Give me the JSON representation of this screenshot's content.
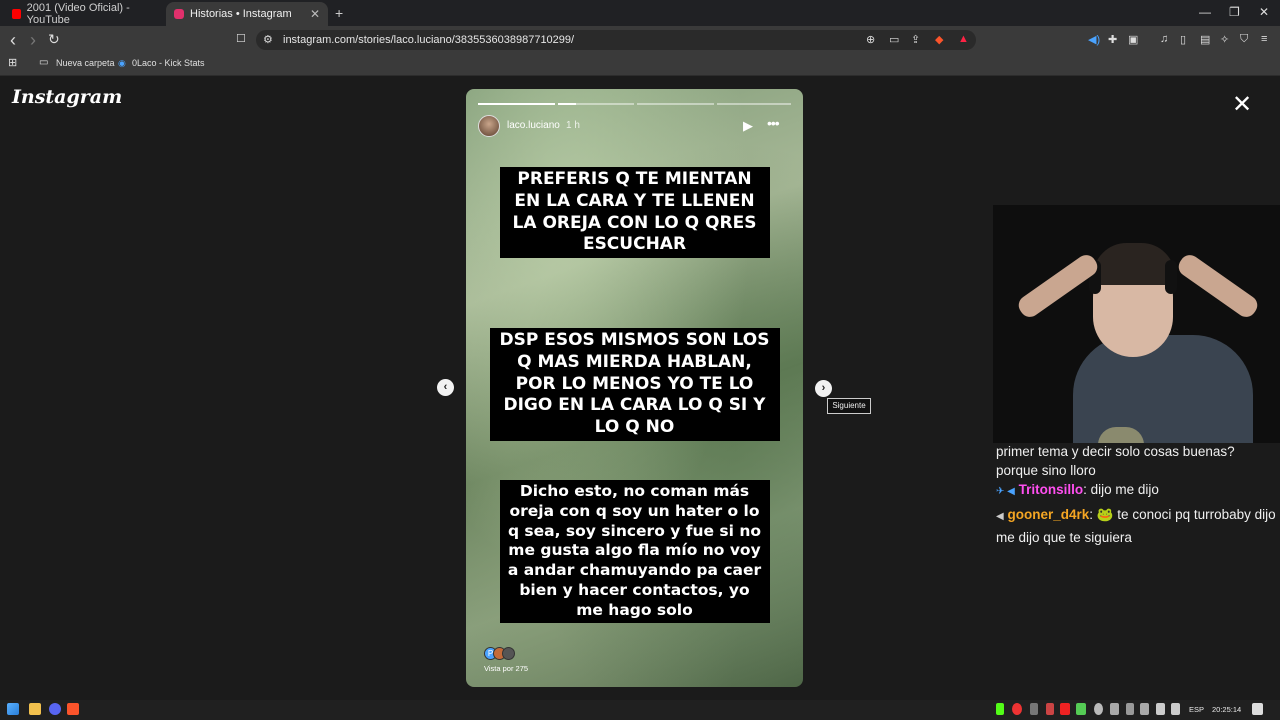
{
  "browser": {
    "tabs": [
      {
        "title": "2001 (Video Oficial) - YouTube",
        "active": false,
        "favicon_color": "#ff0000"
      },
      {
        "title": "Historias • Instagram",
        "active": true,
        "favicon_color": "#e1306c"
      }
    ],
    "new_tab_label": "+",
    "window_controls": {
      "minimize": "—",
      "restore": "❐",
      "close": "✕"
    },
    "nav": {
      "back": "‹",
      "forward": "›",
      "reload": "↻",
      "bookmark": "☐"
    },
    "url": "instagram.com/stories/laco.luciano/3835536038987710299/",
    "bookmarks": [
      "Nueva carpeta",
      "0Laco - Kick Stats"
    ]
  },
  "instagram": {
    "logo": "Instagram",
    "close_icon": "✕",
    "story": {
      "username": "laco.luciano",
      "time": "1 h",
      "play_icon": "▶",
      "more_icon": "•••",
      "progress_segments": 4,
      "progress_current": 1,
      "text_block_1": "PREFERIS Q TE MIENTAN EN LA CARA Y TE LLENEN LA OREJA CON LO Q QRES ESCUCHAR",
      "text_block_2": "DSP ESOS MISMOS SON LOS Q MAS MIERDA HABLAN, POR LO MENOS YO TE LO DIGO EN LA CARA LO Q SI Y LO Q NO",
      "text_block_3": "Dicho esto, no coman más oreja con q soy un hater o lo q sea, soy sincero y fue si no me gusta algo fla mío no voy a andar chamuyando pa caer bien y hacer contactos, yo me hago solo",
      "viewer_avatar_letter": "P",
      "viewed_by": "Vista por 275"
    },
    "prev_icon": "‹",
    "next_icon": "›",
    "tooltip": "Siguiente"
  },
  "chat": {
    "messages": [
      {
        "user": "",
        "text": "primer tema y decir solo cosas buenas? porque sino lloro",
        "color": "#f0f0f0"
      },
      {
        "user": "Tritonsillo",
        "text": ": dijo me dijo",
        "color": "#ff4ff0",
        "badges": "✈ ◀"
      },
      {
        "user": "gooner_d4rk",
        "text": ": 🐸 te conoci pq turrobaby dijo me dijo que te siguiera",
        "color": "#f5a623",
        "badges": "◀"
      }
    ]
  },
  "taskbar": {
    "language": "ESP",
    "time": "20:25:14"
  }
}
